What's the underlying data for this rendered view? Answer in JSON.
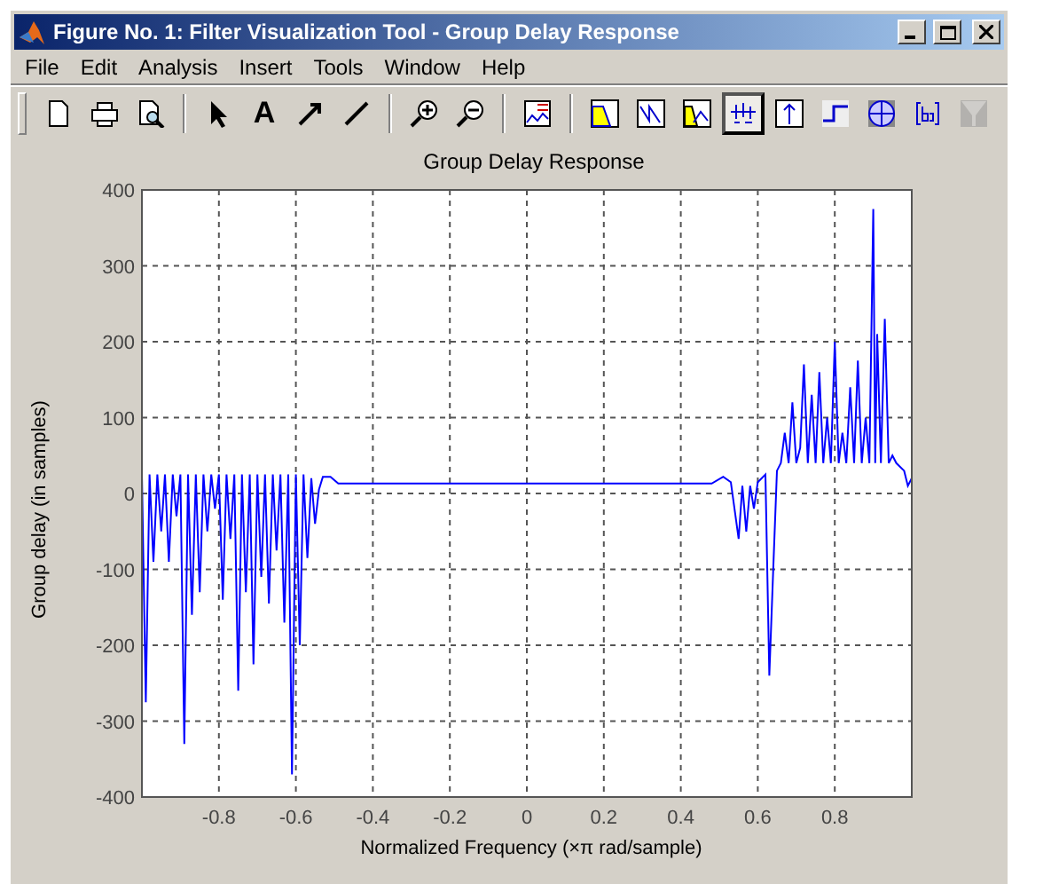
{
  "window": {
    "title": "Figure No. 1: Filter Visualization Tool - Group Delay Response"
  },
  "menu": [
    "File",
    "Edit",
    "Analysis",
    "Insert",
    "Tools",
    "Window",
    "Help"
  ],
  "toolbar": [
    [
      {
        "kind": "new",
        "selected": false,
        "disabled": false
      },
      {
        "kind": "print",
        "selected": false,
        "disabled": false
      },
      {
        "kind": "preview",
        "selected": false,
        "disabled": false
      }
    ],
    [
      {
        "kind": "select",
        "selected": false,
        "disabled": false
      },
      {
        "kind": "text",
        "label": "A",
        "selected": false,
        "disabled": false
      },
      {
        "kind": "arrow",
        "selected": false,
        "disabled": false
      },
      {
        "kind": "line",
        "selected": false,
        "disabled": false
      }
    ],
    [
      {
        "kind": "zoomin",
        "selected": false,
        "disabled": false
      },
      {
        "kind": "zoomout",
        "selected": false,
        "disabled": false
      }
    ],
    [
      {
        "kind": "legend",
        "selected": false,
        "disabled": false
      }
    ],
    [
      {
        "kind": "magnitude",
        "selected": false,
        "disabled": false
      },
      {
        "kind": "phase",
        "selected": false,
        "disabled": false
      },
      {
        "kind": "magphase",
        "selected": false,
        "disabled": false
      },
      {
        "kind": "groupdelay",
        "selected": true,
        "disabled": false
      },
      {
        "kind": "impulse",
        "selected": false,
        "disabled": false
      },
      {
        "kind": "step",
        "selected": false,
        "disabled": false
      },
      {
        "kind": "polezero",
        "selected": false,
        "disabled": false
      },
      {
        "kind": "coeffs",
        "selected": false,
        "disabled": false
      },
      {
        "kind": "info",
        "selected": false,
        "disabled": true
      }
    ]
  ],
  "figure": {
    "chart_data": {
      "type": "line",
      "grid": true,
      "title": "Group Delay Response",
      "xlabel": "Normalized Frequency  (×π rad/sample)",
      "ylabel": "Group delay (in samples)",
      "xlim": [
        -1,
        1
      ],
      "ylim": [
        -400,
        400
      ],
      "xticks": [
        -0.8,
        -0.6,
        -0.4,
        -0.2,
        0,
        0.2,
        0.4,
        0.6,
        0.8
      ],
      "yticks": [
        -400,
        -300,
        -200,
        -100,
        0,
        100,
        200,
        300,
        400
      ],
      "x": [
        -1,
        -0.99,
        -0.98,
        -0.97,
        -0.96,
        -0.95,
        -0.94,
        -0.93,
        -0.92,
        -0.91,
        -0.9,
        -0.89,
        -0.88,
        -0.87,
        -0.86,
        -0.85,
        -0.84,
        -0.83,
        -0.82,
        -0.81,
        -0.8,
        -0.79,
        -0.78,
        -0.77,
        -0.76,
        -0.75,
        -0.74,
        -0.73,
        -0.72,
        -0.71,
        -0.7,
        -0.69,
        -0.68,
        -0.67,
        -0.66,
        -0.65,
        -0.64,
        -0.63,
        -0.62,
        -0.61,
        -0.6,
        -0.59,
        -0.58,
        -0.57,
        -0.56,
        -0.55,
        -0.54,
        -0.53,
        -0.51,
        -0.49,
        -0.2,
        0.2,
        0.48,
        0.51,
        0.53,
        0.55,
        0.56,
        0.57,
        0.58,
        0.59,
        0.6,
        0.62,
        0.63,
        0.64,
        0.65,
        0.66,
        0.67,
        0.68,
        0.69,
        0.7,
        0.71,
        0.72,
        0.73,
        0.74,
        0.75,
        0.76,
        0.77,
        0.78,
        0.79,
        0.8,
        0.81,
        0.82,
        0.83,
        0.84,
        0.85,
        0.86,
        0.87,
        0.88,
        0.89,
        0.9,
        0.905,
        0.91,
        0.92,
        0.93,
        0.94,
        0.95,
        0.96,
        0.98,
        0.99,
        1
      ],
      "series": [
        {
          "color": "#0000ff",
          "values": [
            25,
            -275,
            25,
            -90,
            25,
            -50,
            25,
            -90,
            25,
            -30,
            25,
            -330,
            25,
            -160,
            25,
            -130,
            25,
            -50,
            25,
            -20,
            25,
            -140,
            25,
            -60,
            25,
            -260,
            25,
            -130,
            25,
            -225,
            25,
            -110,
            25,
            -145,
            25,
            -75,
            25,
            -170,
            25,
            -370,
            25,
            -200,
            25,
            -85,
            20,
            -40,
            5,
            22,
            22,
            13,
            13,
            13,
            13,
            22,
            15,
            -60,
            10,
            -50,
            10,
            -20,
            15,
            25,
            -240,
            -100,
            30,
            40,
            80,
            40,
            120,
            40,
            60,
            170,
            40,
            130,
            40,
            160,
            40,
            100,
            40,
            200,
            40,
            80,
            40,
            140,
            40,
            175,
            40,
            100,
            40,
            375,
            40,
            210,
            40,
            230,
            40,
            50,
            40,
            30,
            10,
            20
          ]
        }
      ]
    }
  }
}
